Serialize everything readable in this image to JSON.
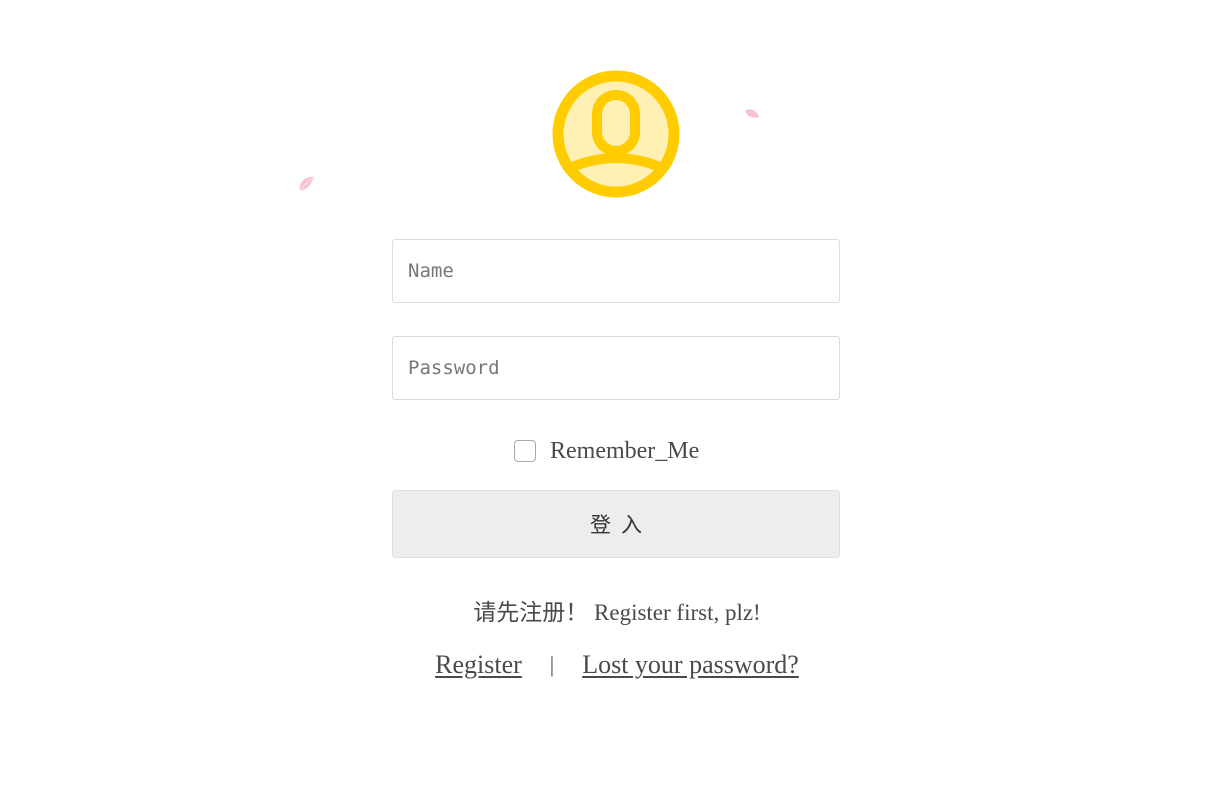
{
  "colors": {
    "avatar_ring": "#ffcc00",
    "avatar_fill": "#fff0b3",
    "petal": "#f6b8c9"
  },
  "icons": {
    "avatar": "user-avatar-icon",
    "petal": "sakura-petal-icon"
  },
  "form": {
    "name_placeholder": "Name",
    "password_placeholder": "Password",
    "remember_label": "Remember_Me",
    "remember_checked": false,
    "login_label": "登入"
  },
  "notice": "请先注册！ Register first, plz!",
  "links": {
    "register": "Register",
    "separator": "|",
    "lost_password": "Lost your password?"
  }
}
